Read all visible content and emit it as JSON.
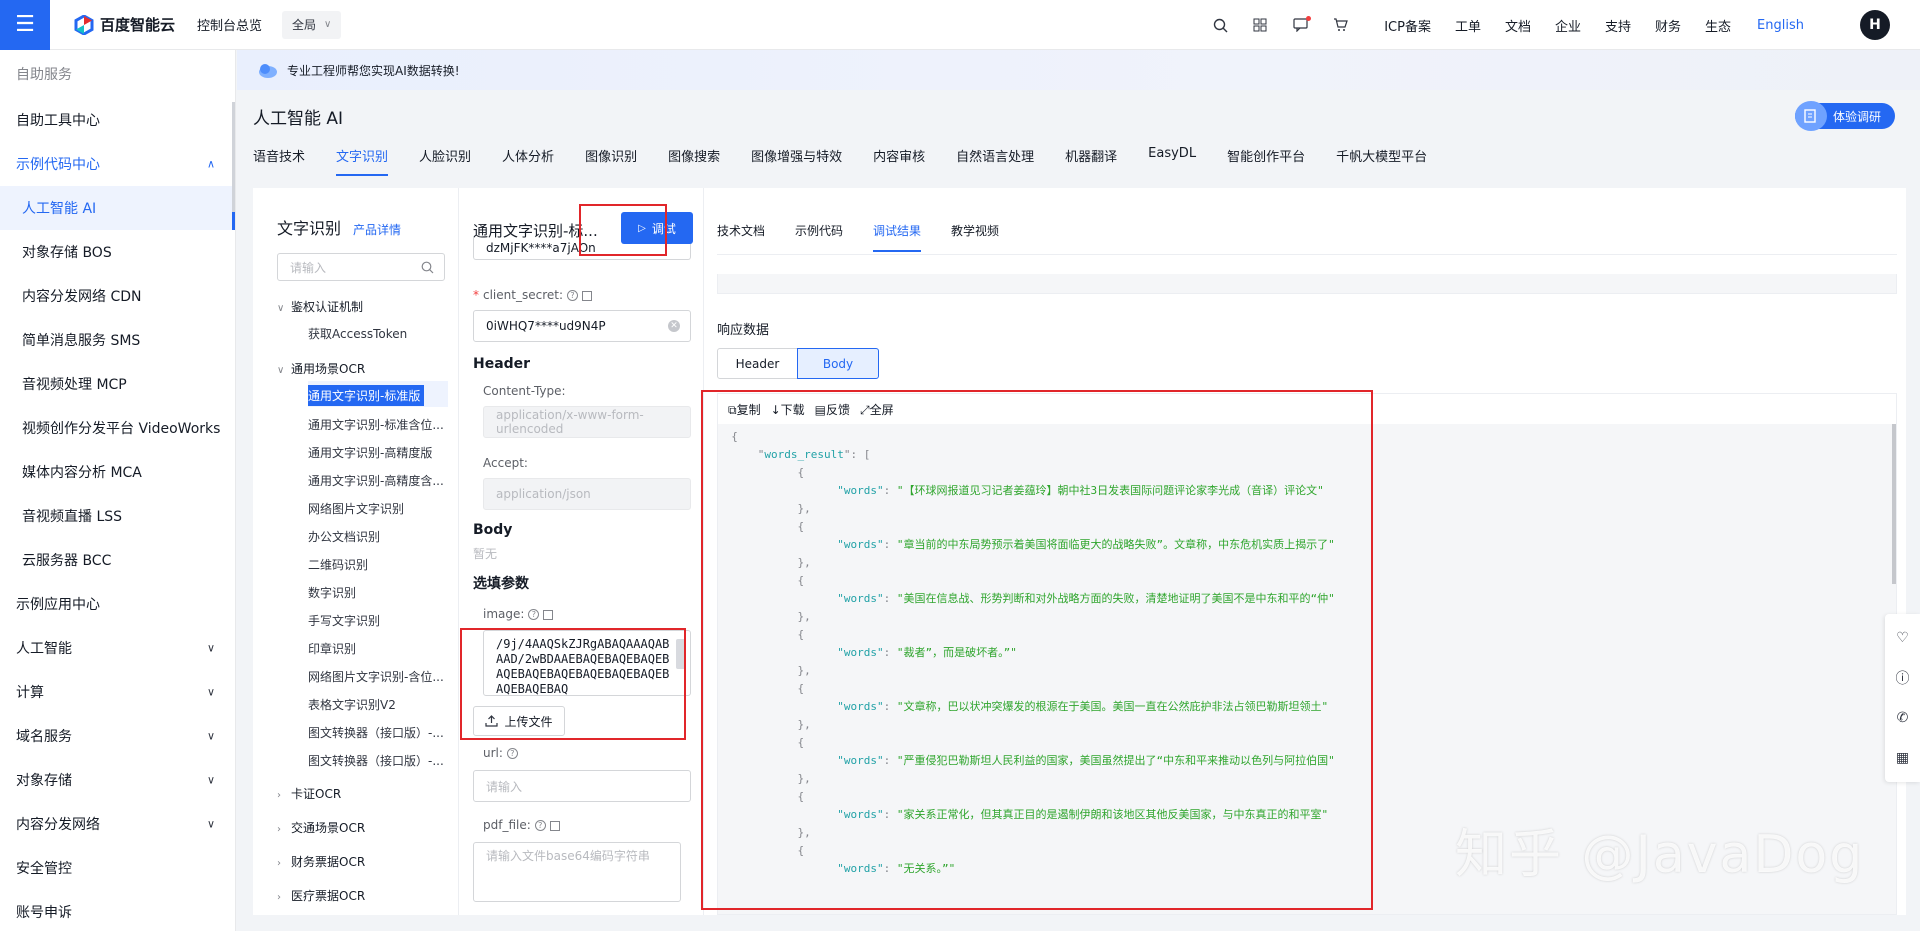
{
  "topbar": {
    "brand": "百度智能云",
    "console_link": "控制台总览",
    "region": "全局",
    "nav": [
      "ICP备案",
      "工单",
      "文档",
      "企业",
      "支持",
      "财务",
      "生态"
    ],
    "language": "English",
    "avatar_letter": "H"
  },
  "sidebar": {
    "items": [
      {
        "label": "自助服务"
      },
      {
        "label": "自助工具中心"
      },
      {
        "label": "示例代码中心"
      },
      {
        "label": "人工智能 AI"
      },
      {
        "label": "对象存储 BOS"
      },
      {
        "label": "内容分发网络 CDN"
      },
      {
        "label": "简单消息服务 SMS"
      },
      {
        "label": "音视频处理 MCP"
      },
      {
        "label": "视频创作分发平台 VideoWorks"
      },
      {
        "label": "媒体内容分析 MCA"
      },
      {
        "label": "音视频直播 LSS"
      },
      {
        "label": "云服务器 BCC"
      },
      {
        "label": "示例应用中心"
      },
      {
        "label": "人工智能"
      },
      {
        "label": "计算"
      },
      {
        "label": "域名服务"
      },
      {
        "label": "对象存储"
      },
      {
        "label": "内容分发网络"
      },
      {
        "label": "安全管控"
      },
      {
        "label": "账号申诉"
      }
    ]
  },
  "banner": {
    "text": "专业工程师帮您实现AI数据转换!"
  },
  "page": {
    "title": "人工智能 AI",
    "survey_label": "体验调研",
    "tabs": [
      "语音技术",
      "文字识别",
      "人脸识别",
      "人体分析",
      "图像识别",
      "图像搜索",
      "图像增强与特效",
      "内容审核",
      "自然语言处理",
      "机器翻译",
      "EasyDL",
      "智能创作平台",
      "千帆大模型平台"
    ]
  },
  "tree": {
    "title": "文字识别",
    "detail_link": "产品详情",
    "search_placeholder": "请输入",
    "groups": [
      {
        "label": "鉴权认证机制",
        "leaves": [
          "获取AccessToken"
        ]
      },
      {
        "label": "通用场景OCR",
        "leaves": [
          "通用文字识别-标准版",
          "通用文字识别-标准含位...",
          "通用文字识别-高精度版",
          "通用文字识别-高精度含...",
          "网络图片文字识别",
          "办公文档识别",
          "二维码识别",
          "数字识别",
          "手写文字识别",
          "印章识别",
          "网络图片文字识别-含位...",
          "表格文字识别V2",
          "图文转换器（接口版）-...",
          "图文转换器（接口版）-..."
        ]
      },
      {
        "label": "卡证OCR"
      },
      {
        "label": "交通场景OCR"
      },
      {
        "label": "财务票据OCR"
      },
      {
        "label": "医疗票据OCR"
      }
    ]
  },
  "form": {
    "title": "通用文字识别-标...",
    "run_label": "调试",
    "client_id_value": "dzMjFK****a7jAOn",
    "client_secret_label": "client_secret:",
    "client_secret_value": "0iWHQ7****ud9N4P",
    "header_section": "Header",
    "content_type_label": "Content-Type:",
    "content_type_value": "application/x-www-form-urlencoded",
    "accept_label": "Accept:",
    "accept_value": "application/json",
    "body_section": "Body",
    "body_none": "暂无",
    "optional_section": "选填参数",
    "image_label": "image:",
    "image_value": "/9j/4AAQSkZJRgABAQAAAQABAAD/2wBDAAEBAQEBAQEBAQEBAQEBAQEBAQEBAQEBAQEBAQEBAQEBAQEBAQ",
    "upload_label": "上传文件",
    "url_label": "url:",
    "url_placeholder": "请输入",
    "pdf_label": "pdf_file:",
    "pdf_placeholder": "请输入文件base64编码字符串"
  },
  "result": {
    "tabs": [
      "技术文档",
      "示例代码",
      "调试结果",
      "教学视频"
    ],
    "response_label": "响应数据",
    "seg_header": "Header",
    "seg_body": "Body",
    "tools": [
      "复制",
      "下载",
      "反馈",
      "全屏"
    ],
    "key": "words_result",
    "words": [
      "【环球网报道见习记者姜蕴玲】朝中社3日发表国际问题评论家李光成（音译）评论文",
      "章当前的中东局势预示着美国将面临更大的战略失败”。文章称，中东危机实质上揭示了",
      "美国在信息战、形势判断和对外战略方面的失败，清楚地证明了美国不是中东和平的“仲",
      "裁者”，而是破坏者。”",
      "文章称，巴以状冲突爆发的根源在于美国。美国一直在公然庇护非法占领巴勒斯坦领土",
      "严重侵犯巴勒斯坦人民利益的国家，美国虽然提出了“中东和平来推动以色列与阿拉伯国",
      "家关系正常化，但其真正目的是遏制伊朗和该地区其他反美国家，与中东真正的和平室",
      "无关系。”"
    ]
  },
  "watermark": "知乎 @JavaDog",
  "colors": {
    "primary": "#2468f2",
    "annotation_red": "#e1262a",
    "json_key": "#22a2a7",
    "json_string": "#2fa52d"
  }
}
